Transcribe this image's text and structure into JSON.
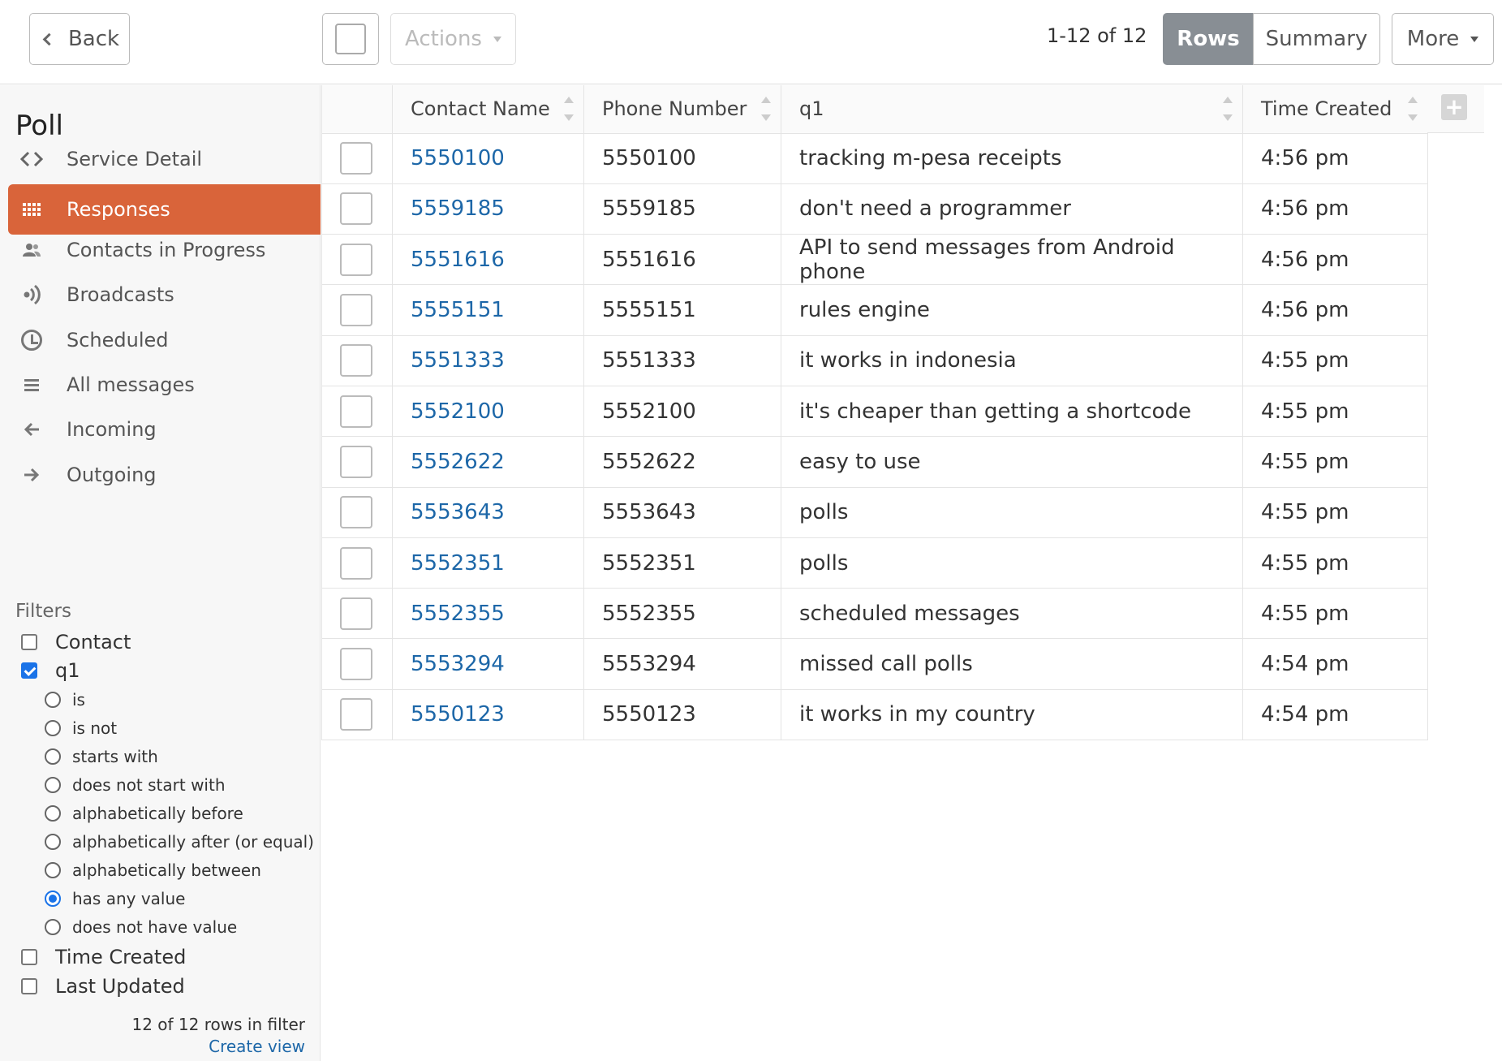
{
  "toolbar": {
    "back_label": "Back",
    "actions_label": "Actions",
    "pager_text": "1-12 of 12",
    "rows_label": "Rows",
    "summary_label": "Summary",
    "more_label": "More"
  },
  "sidebar": {
    "title": "Poll",
    "nav": [
      {
        "label": "Service Detail",
        "icon": "code-icon"
      },
      {
        "label": "Responses",
        "icon": "grid-icon",
        "active": true
      },
      {
        "label": "Contacts in Progress",
        "icon": "users-icon"
      },
      {
        "label": "Broadcasts",
        "icon": "broadcast-icon"
      },
      {
        "label": "Scheduled",
        "icon": "clock-icon"
      },
      {
        "label": "All messages",
        "icon": "list-icon"
      },
      {
        "label": "Incoming",
        "icon": "arrow-left-icon"
      },
      {
        "label": "Outgoing",
        "icon": "arrow-right-icon"
      }
    ],
    "filters_title": "Filters",
    "filter_fields": [
      {
        "label": "Contact",
        "checked": false
      },
      {
        "label": "q1",
        "checked": true
      },
      {
        "label": "Time Created",
        "checked": false
      },
      {
        "label": "Last Updated",
        "checked": false
      }
    ],
    "q1_options": [
      {
        "label": "is",
        "selected": false
      },
      {
        "label": "is not",
        "selected": false
      },
      {
        "label": "starts with",
        "selected": false
      },
      {
        "label": "does not start with",
        "selected": false
      },
      {
        "label": "alphabetically before",
        "selected": false
      },
      {
        "label": "alphabetically after (or equal)",
        "selected": false
      },
      {
        "label": "alphabetically between",
        "selected": false
      },
      {
        "label": "has any value",
        "selected": true
      },
      {
        "label": "does not have value",
        "selected": false
      }
    ],
    "rows_in_filter": "12 of 12 rows in filter",
    "create_view": "Create view"
  },
  "table": {
    "columns": [
      "Contact Name",
      "Phone Number",
      "q1",
      "Time Created"
    ],
    "rows": [
      {
        "name": "5550100",
        "phone": "5550100",
        "q1": "tracking m-pesa receipts",
        "time": "4:56 pm"
      },
      {
        "name": "5559185",
        "phone": "5559185",
        "q1": "don't need a programmer",
        "time": "4:56 pm"
      },
      {
        "name": "5551616",
        "phone": "5551616",
        "q1": "API to send messages from Android phone",
        "time": "4:56 pm"
      },
      {
        "name": "5555151",
        "phone": "5555151",
        "q1": "rules engine",
        "time": "4:56 pm"
      },
      {
        "name": "5551333",
        "phone": "5551333",
        "q1": "it works in indonesia",
        "time": "4:55 pm"
      },
      {
        "name": "5552100",
        "phone": "5552100",
        "q1": "it's cheaper than getting a shortcode",
        "time": "4:55 pm"
      },
      {
        "name": "5552622",
        "phone": "5552622",
        "q1": "easy to use",
        "time": "4:55 pm"
      },
      {
        "name": "5553643",
        "phone": "5553643",
        "q1": "polls",
        "time": "4:55 pm"
      },
      {
        "name": "5552351",
        "phone": "5552351",
        "q1": "polls",
        "time": "4:55 pm"
      },
      {
        "name": "5552355",
        "phone": "5552355",
        "q1": "scheduled messages",
        "time": "4:55 pm"
      },
      {
        "name": "5553294",
        "phone": "5553294",
        "q1": "missed call polls",
        "time": "4:54 pm"
      },
      {
        "name": "5550123",
        "phone": "5550123",
        "q1": "it works in my country",
        "time": "4:54 pm"
      }
    ]
  },
  "colors": {
    "accent": "#d9643a",
    "link": "#1d67a8",
    "toggle_active": "#888e94",
    "checkbox": "#1a73e8"
  }
}
